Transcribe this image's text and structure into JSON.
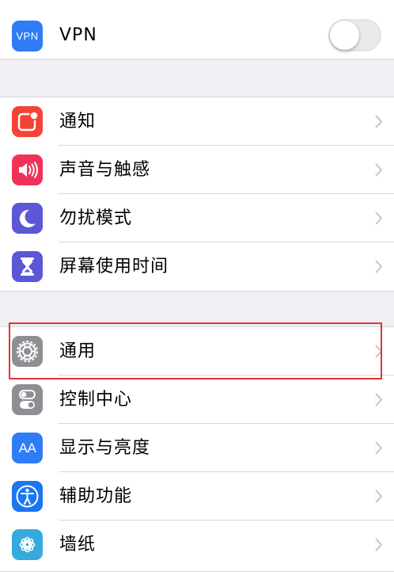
{
  "vpn": {
    "icon_text": "VPN",
    "label": "VPN",
    "toggle_on": false
  },
  "group1": [
    {
      "label": "通知",
      "icon": "notifications-icon",
      "color": "#f44336"
    },
    {
      "label": "声音与触感",
      "icon": "sound-icon",
      "color": "#f0325a"
    },
    {
      "label": "勿扰模式",
      "icon": "moon-icon",
      "color": "#5b57d6"
    },
    {
      "label": "屏幕使用时间",
      "icon": "hourglass-icon",
      "color": "#5b57d6"
    }
  ],
  "group2": [
    {
      "label": "通用",
      "icon": "gear-icon",
      "color": "#8e8e93"
    },
    {
      "label": "控制中心",
      "icon": "control-center-icon",
      "color": "#8e8e93"
    },
    {
      "label": "显示与亮度",
      "icon": "display-icon",
      "color": "#2f7cf6",
      "icon_text": "AA"
    },
    {
      "label": "辅助功能",
      "icon": "accessibility-icon",
      "color": "#1a76f2"
    },
    {
      "label": "墙纸",
      "icon": "wallpaper-icon",
      "color": "#36aadc"
    }
  ],
  "highlight_color": "#e0343a"
}
